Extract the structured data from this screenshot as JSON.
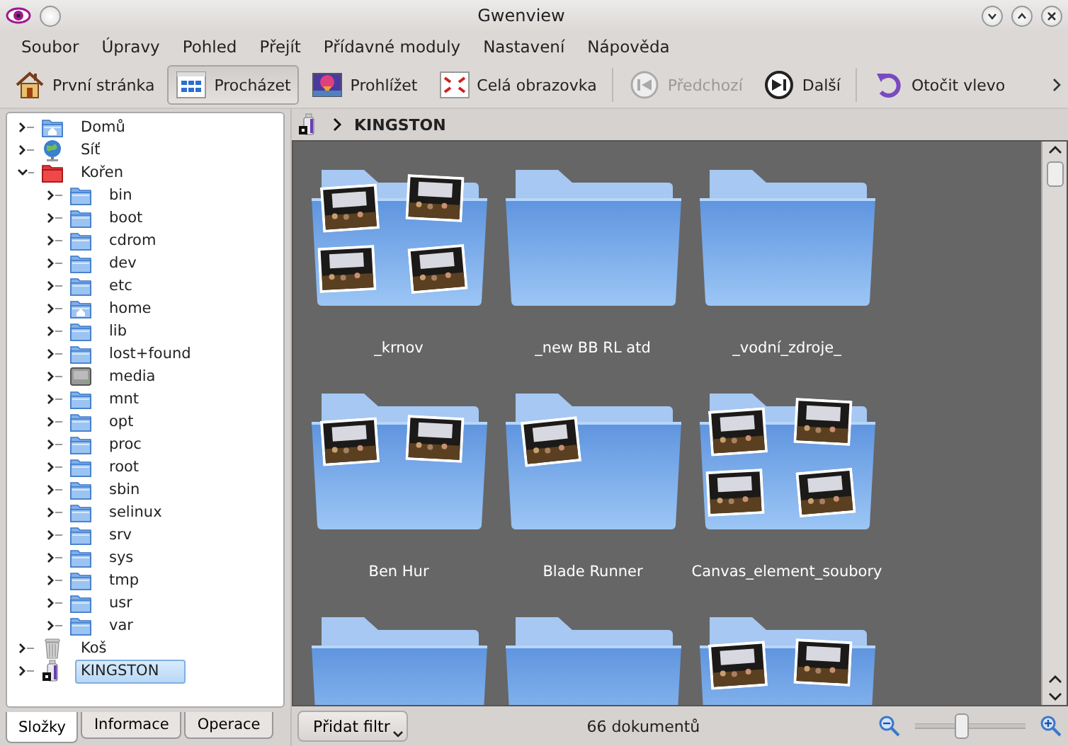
{
  "window": {
    "title": "Gwenview"
  },
  "menu": [
    "Soubor",
    "Úpravy",
    "Pohled",
    "Přejít",
    "Přídavné moduly",
    "Nastavení",
    "Nápověda"
  ],
  "toolbar": [
    {
      "kind": "home",
      "label": "První stránka",
      "selected": false,
      "disabled": false
    },
    {
      "kind": "browse",
      "label": "Procházet",
      "selected": true,
      "disabled": false
    },
    {
      "kind": "view",
      "label": "Prohlížet",
      "selected": false,
      "disabled": false
    },
    {
      "kind": "fullscreen",
      "label": "Celá obrazovka",
      "selected": false,
      "disabled": false
    },
    {
      "kind": "separator"
    },
    {
      "kind": "previous",
      "label": "Předchozí",
      "selected": false,
      "disabled": true
    },
    {
      "kind": "next",
      "label": "Další",
      "selected": false,
      "disabled": false
    },
    {
      "kind": "separator"
    },
    {
      "kind": "rotate-left",
      "label": "Otočit vlevo",
      "selected": false,
      "disabled": false
    }
  ],
  "tree": [
    {
      "label": "Domů",
      "kind": "home-folder",
      "expanded": false,
      "selected": false
    },
    {
      "label": "Síť",
      "kind": "globe",
      "expanded": false,
      "selected": false
    },
    {
      "label": "Kořen",
      "kind": "red-folder",
      "expanded": true,
      "selected": false,
      "children": [
        {
          "label": "bin",
          "kind": "folder",
          "expanded": false,
          "selected": false
        },
        {
          "label": "boot",
          "kind": "folder",
          "expanded": false,
          "selected": false
        },
        {
          "label": "cdrom",
          "kind": "folder",
          "expanded": false,
          "selected": false
        },
        {
          "label": "dev",
          "kind": "folder",
          "expanded": false,
          "selected": false
        },
        {
          "label": "etc",
          "kind": "folder",
          "expanded": false,
          "selected": false
        },
        {
          "label": "home",
          "kind": "home-folder",
          "expanded": false,
          "selected": false
        },
        {
          "label": "lib",
          "kind": "folder",
          "expanded": false,
          "selected": false
        },
        {
          "label": "lost+found",
          "kind": "folder",
          "expanded": false,
          "selected": false
        },
        {
          "label": "media",
          "kind": "drive",
          "expanded": false,
          "selected": false
        },
        {
          "label": "mnt",
          "kind": "folder",
          "expanded": false,
          "selected": false
        },
        {
          "label": "opt",
          "kind": "folder",
          "expanded": false,
          "selected": false
        },
        {
          "label": "proc",
          "kind": "folder",
          "expanded": false,
          "selected": false
        },
        {
          "label": "root",
          "kind": "folder",
          "expanded": false,
          "selected": false
        },
        {
          "label": "sbin",
          "kind": "folder",
          "expanded": false,
          "selected": false
        },
        {
          "label": "selinux",
          "kind": "folder",
          "expanded": false,
          "selected": false
        },
        {
          "label": "srv",
          "kind": "folder",
          "expanded": false,
          "selected": false
        },
        {
          "label": "sys",
          "kind": "folder",
          "expanded": false,
          "selected": false
        },
        {
          "label": "tmp",
          "kind": "folder",
          "expanded": false,
          "selected": false
        },
        {
          "label": "usr",
          "kind": "folder",
          "expanded": false,
          "selected": false
        },
        {
          "label": "var",
          "kind": "folder",
          "expanded": false,
          "selected": false
        }
      ]
    },
    {
      "label": "Koš",
      "kind": "trash",
      "expanded": false,
      "selected": false
    },
    {
      "label": "KINGSTON",
      "kind": "usb",
      "expanded": false,
      "selected": true
    }
  ],
  "side_tabs": [
    {
      "label": "Složky",
      "selected": true
    },
    {
      "label": "Informace",
      "selected": false
    },
    {
      "label": "Operace",
      "selected": false
    }
  ],
  "breadcrumb": {
    "location": "KINGSTON"
  },
  "folders": [
    {
      "kind": "folder",
      "label": "_krnov"
    },
    {
      "kind": "folder",
      "label": "_new BB RL atd"
    },
    {
      "kind": "folder",
      "label": "_vodní_zdroje_"
    },
    {
      "kind": "folder",
      "label": "Ben Hur"
    },
    {
      "kind": "folder",
      "label": "Blade Runner"
    },
    {
      "kind": "folder",
      "label": "Canvas_element_soubory"
    },
    {
      "kind": "folder"
    },
    {
      "kind": "folder"
    },
    {
      "kind": "folder"
    }
  ],
  "status_bar": {
    "filter_button": "Přidat filtr",
    "count": "66 dokumentů",
    "zoom": {
      "level": 0.42
    }
  }
}
